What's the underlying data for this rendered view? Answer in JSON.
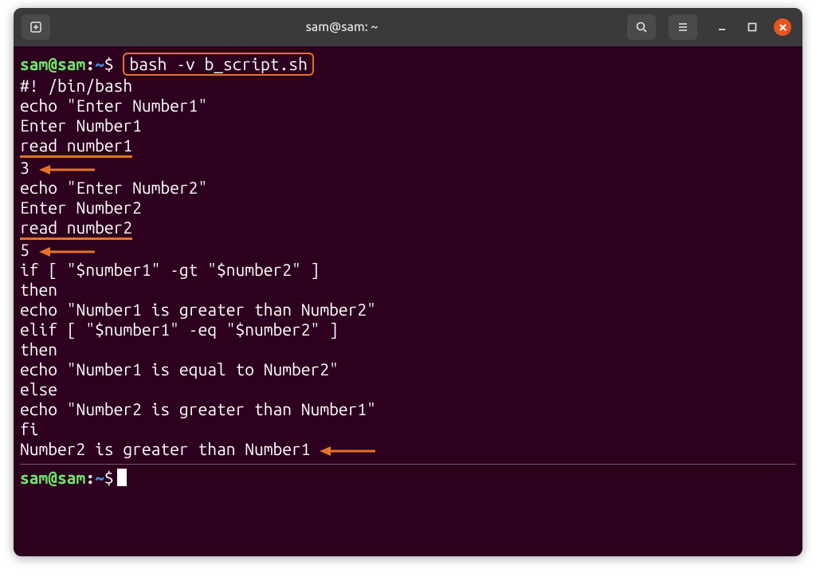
{
  "titlebar": {
    "title": "sam@sam: ~"
  },
  "prompt": {
    "userhost": "sam@sam",
    "colon": ":",
    "path": "~",
    "dollar": "$"
  },
  "command_boxed": "bash -v b_script.sh",
  "lines": {
    "shebang": "#! /bin/bash",
    "echo1": "echo \"Enter Number1\"",
    "out1": "Enter Number1",
    "read1": "read number1",
    "inp1": "3",
    "echo2": "echo \"Enter Number2\"",
    "out2": "Enter Number2",
    "read2": "read number2",
    "inp2": "5",
    "if": "if [ \"$number1\" -gt \"$number2\" ]",
    "then1": "then",
    "e_gt": "echo \"Number1 is greater than Number2\"",
    "elif": "elif [ \"$number1\" -eq \"$number2\" ]",
    "then2": "then",
    "e_eq": "echo \"Number1 is equal to Number2\"",
    "else": "else",
    "e_lt": "echo \"Number2 is greater than Number1\"",
    "fi": "fi",
    "result": "Number2 is greater than Number1"
  },
  "colors": {
    "orange": "#e57327",
    "bg": "#2c001e",
    "user": "#6be76b",
    "path": "#4a90d9"
  }
}
